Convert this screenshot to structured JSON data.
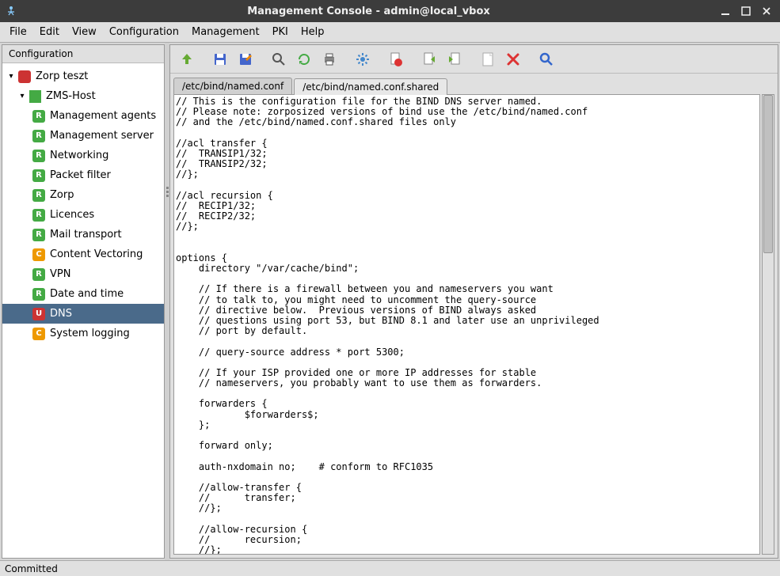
{
  "window": {
    "title": "Management Console - admin@local_vbox"
  },
  "menubar": [
    "File",
    "Edit",
    "View",
    "Configuration",
    "Management",
    "PKI",
    "Help"
  ],
  "sidebar": {
    "header": "Configuration",
    "root": {
      "label": "Zorp teszt",
      "badge": "red",
      "letter": ""
    },
    "host": {
      "label": "ZMS-Host"
    },
    "items": [
      {
        "label": "Management agents",
        "badge": "green",
        "letter": "R"
      },
      {
        "label": "Management server",
        "badge": "green",
        "letter": "R"
      },
      {
        "label": "Networking",
        "badge": "green",
        "letter": "R"
      },
      {
        "label": "Packet filter",
        "badge": "green",
        "letter": "R"
      },
      {
        "label": "Zorp",
        "badge": "green",
        "letter": "R"
      },
      {
        "label": "Licences",
        "badge": "green",
        "letter": "R"
      },
      {
        "label": "Mail transport",
        "badge": "green",
        "letter": "R"
      },
      {
        "label": "Content Vectoring",
        "badge": "orange",
        "letter": "C"
      },
      {
        "label": "VPN",
        "badge": "green",
        "letter": "R"
      },
      {
        "label": "Date and time",
        "badge": "green",
        "letter": "R"
      },
      {
        "label": "DNS",
        "badge": "red",
        "letter": "U",
        "selected": true
      },
      {
        "label": "System logging",
        "badge": "orange",
        "letter": "C"
      }
    ]
  },
  "tabs": [
    {
      "label": "/etc/bind/named.conf",
      "active": false
    },
    {
      "label": "/etc/bind/named.conf.shared",
      "active": true
    }
  ],
  "toolbar_icons": [
    "up-icon",
    "sep",
    "save-icon",
    "save-as-icon",
    "sep",
    "zoom-icon",
    "reload-icon",
    "print-icon",
    "sep",
    "gear-icon",
    "sep",
    "doc-red-icon",
    "sep",
    "doc-out-icon",
    "doc-in-icon",
    "sep",
    "new-doc-icon",
    "delete-icon",
    "sep",
    "search-icon"
  ],
  "editor": {
    "content": "// This is the configuration file for the BIND DNS server named.\n// Please note: zorposized versions of bind use the /etc/bind/named.conf\n// and the /etc/bind/named.conf.shared files only\n\n//acl transfer {\n//  TRANSIP1/32;\n//  TRANSIP2/32;\n//};\n\n//acl recursion {\n//  RECIP1/32;\n//  RECIP2/32;\n//};\n\n\noptions {\n    directory \"/var/cache/bind\";\n\n    // If there is a firewall between you and nameservers you want\n    // to talk to, you might need to uncomment the query-source\n    // directive below.  Previous versions of BIND always asked\n    // questions using port 53, but BIND 8.1 and later use an unprivileged\n    // port by default.\n\n    // query-source address * port 5300;\n\n    // If your ISP provided one or more IP addresses for stable\n    // nameservers, you probably want to use them as forwarders.\n\n    forwarders {\n            $forwarders$;\n    };\n\n    forward only;\n\n    auth-nxdomain no;    # conform to RFC1035\n\n    //allow-transfer {\n    //      transfer;\n    //};\n\n    //allow-recursion {\n    //      recursion;\n    //};"
  },
  "statusbar": {
    "text": "Committed"
  }
}
